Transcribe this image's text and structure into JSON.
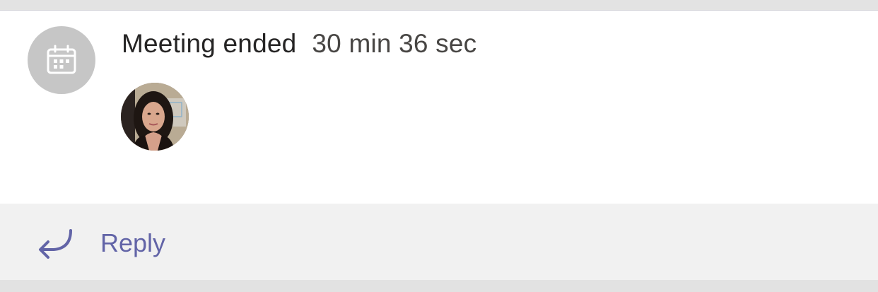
{
  "meeting": {
    "title": "Meeting ended",
    "duration": "30 min 36 sec",
    "icon": "calendar-icon",
    "participants": [
      {
        "avatar": "participant-photo"
      }
    ]
  },
  "reply": {
    "label": "Reply",
    "icon": "reply-arrow-icon",
    "color": "#6264a7"
  },
  "colors": {
    "icon_bg": "#c6c6c6",
    "reply_bar_bg": "#f1f1f1",
    "card_bg": "#ffffff"
  }
}
